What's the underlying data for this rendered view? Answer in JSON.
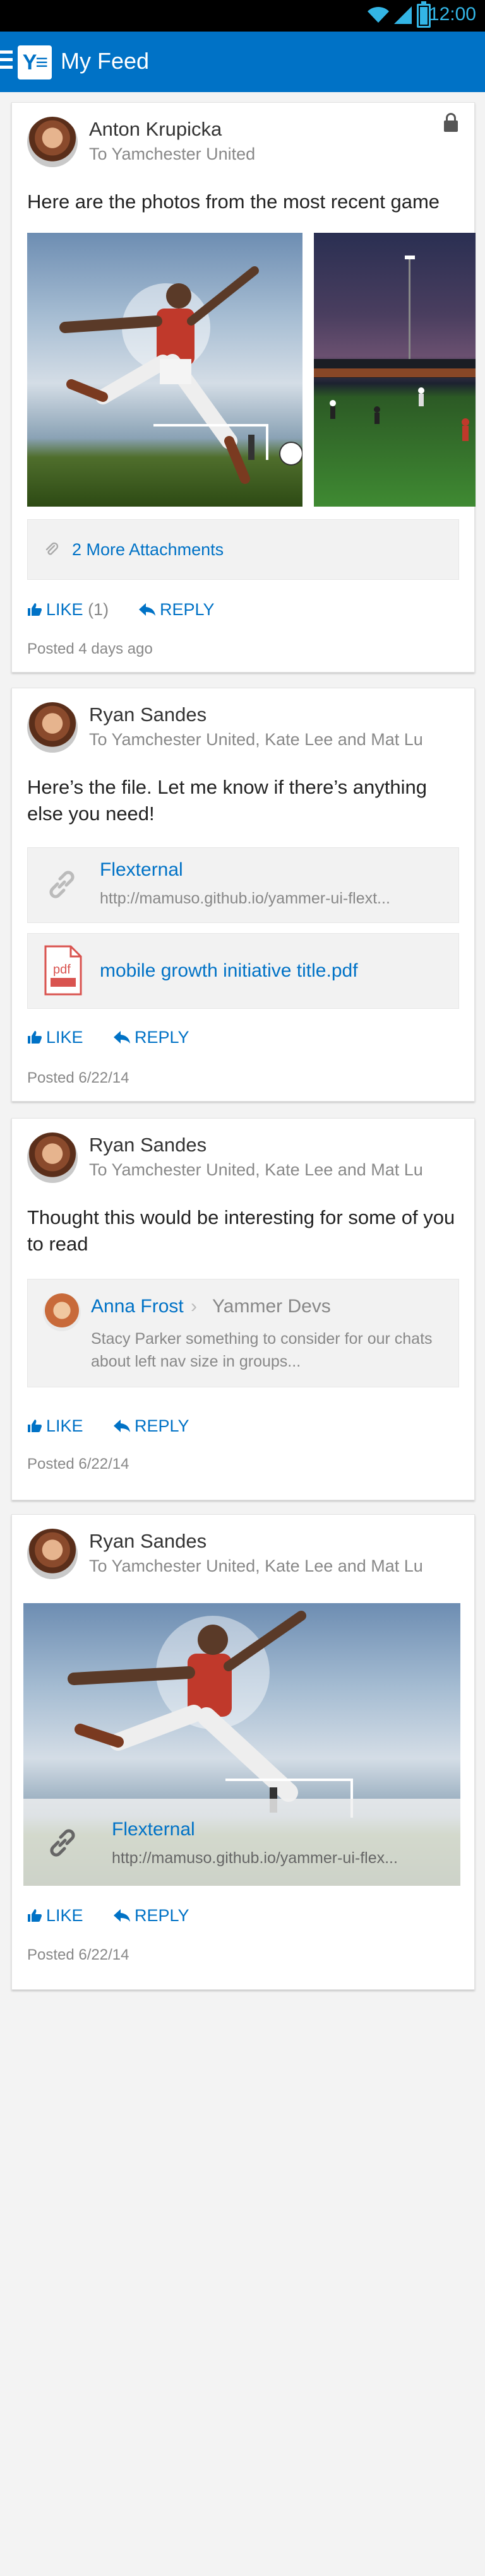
{
  "status": {
    "time": "12:00"
  },
  "appbar": {
    "title": "My Feed",
    "logo": "Y≡"
  },
  "posts": [
    {
      "author": "Anton Krupicka",
      "recipients": "To Yamchester United",
      "text": "Here are the photos from the most recent game",
      "attachments_label": "2 More Attachments",
      "like_label": "LIKE",
      "like_count": "(1)",
      "reply_label": "REPLY",
      "posted": "Posted 4 days ago"
    },
    {
      "author": "Ryan Sandes",
      "recipients": "To Yamchester United, Kate Lee and Mat Lu",
      "text": "Here’s the file. Let me know if there’s anything else you need!",
      "link_title": "Flexternal",
      "link_url": "http://mamuso.github.io/yammer-ui-flext...",
      "file_name": "mobile growth initiative title.pdf",
      "file_icon_text": "pdf",
      "like_label": "LIKE",
      "reply_label": "REPLY",
      "posted": "Posted 6/22/14"
    },
    {
      "author": "Ryan Sandes",
      "recipients": "To Yamchester United, Kate Lee and Mat Lu",
      "text": "Thought this would be interesting for some of you to read",
      "quote_author": "Anna Frost",
      "quote_separator": "›",
      "quote_group": "Yammer Devs",
      "quote_text": "Stacy Parker something to consider for our chats about left nav size in groups...",
      "like_label": "LIKE",
      "reply_label": "REPLY",
      "posted": "Posted 6/22/14"
    },
    {
      "author": "Ryan Sandes",
      "recipients": "To Yamchester United, Kate Lee and Mat Lu",
      "link_title": "Flexternal",
      "link_url": "http://mamuso.github.io/yammer-ui-flex...",
      "like_label": "LIKE",
      "reply_label": "REPLY",
      "posted": "Posted 6/22/14"
    }
  ],
  "colors": {
    "brand": "#0072c6",
    "status_accent": "#33b5e5"
  },
  "icons": [
    "wifi-icon",
    "signal-icon",
    "battery-icon",
    "menu-icon",
    "lock-icon",
    "paperclip-icon",
    "thumbs-up-icon",
    "reply-arrow-icon",
    "link-chain-icon",
    "pdf-file-icon"
  ]
}
